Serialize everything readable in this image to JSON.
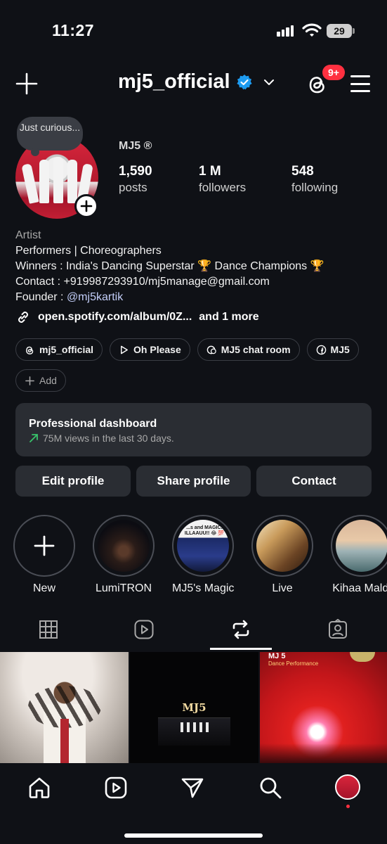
{
  "status_bar": {
    "time": "11:27",
    "battery": "29"
  },
  "header": {
    "username": "mj5_official",
    "notification_badge": "9+"
  },
  "profile": {
    "note": "Just curious...",
    "display_name": "MJ5 ®",
    "stats": [
      {
        "value": "1,590",
        "label": "posts"
      },
      {
        "value": "1 M",
        "label": "followers"
      },
      {
        "value": "548",
        "label": "following"
      }
    ],
    "bio": {
      "category": "Artist",
      "line1": "Performers | Choreographers",
      "line2": "Winners : India's Dancing Superstar 🏆 Dance Champions 🏆",
      "line3": "Contact : +919987293910/mj5manage@gmail.com",
      "founder_prefix": "Founder : ",
      "founder_mention": "@mj5kartik"
    },
    "link": {
      "url": "open.spotify.com/album/0Z...",
      "more": "and 1 more"
    }
  },
  "chips": [
    {
      "label": "mj5_official",
      "icon": "threads-icon"
    },
    {
      "label": "Oh Please",
      "icon": "play-icon"
    },
    {
      "label": "MJ5 chat room",
      "icon": "chat-icon"
    },
    {
      "label": "MJ5",
      "icon": "facebook-icon"
    }
  ],
  "add_chip": "Add",
  "dashboard": {
    "title": "Professional dashboard",
    "subtitle": "75M views in the last 30 days."
  },
  "buttons": {
    "edit": "Edit profile",
    "share": "Share profile",
    "contact": "Contact"
  },
  "highlights": [
    {
      "label": "New"
    },
    {
      "label": "LumiTRON"
    },
    {
      "label": "MJ5's Magic"
    },
    {
      "label": "Live"
    },
    {
      "label": "Kihaa Maldi"
    }
  ],
  "posts": [
    {
      "caption": ""
    },
    {
      "caption": "MJ5"
    },
    {
      "caption": "MJ 5",
      "subcaption": "Dance Performance"
    }
  ],
  "highlight_caption": "...s and MAGIC! ILLAAUU!! 😂 💯",
  "colors": {
    "background": "#0f1116",
    "accent_badge": "#ff3040",
    "verified": "#1d9bf0",
    "mention": "#c3cef9"
  }
}
